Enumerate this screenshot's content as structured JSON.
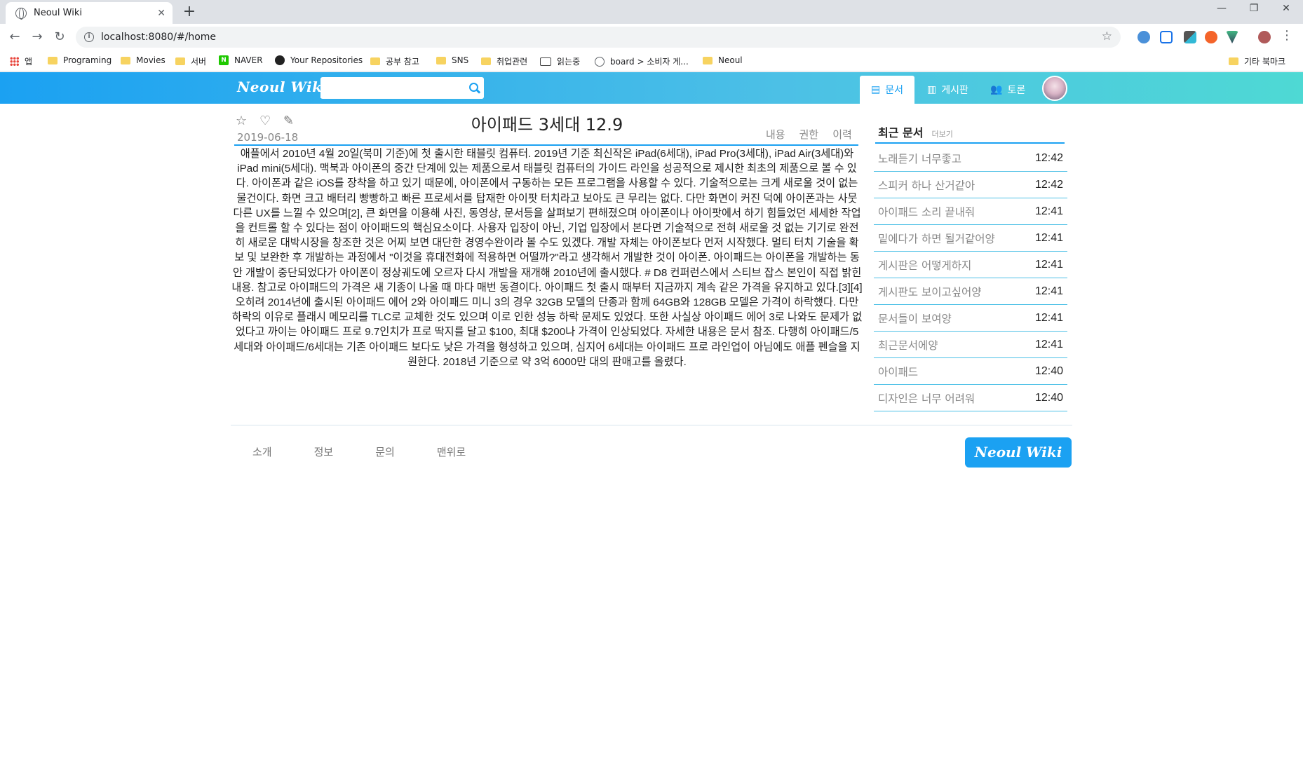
{
  "browser": {
    "tab_title": "Neoul Wiki",
    "tab_close": "✕",
    "new_tab": "+",
    "url": "localhost:8080/#/home",
    "window_controls": [
      "—",
      "❐",
      "✕"
    ],
    "bookmarks": [
      "앱",
      "Programing",
      "Movies",
      "서버",
      "NAVER",
      "Your Repositories",
      "공부 참고",
      "SNS",
      "취업관련",
      "읽는중",
      "board > 소비자 게...",
      "Neoul"
    ],
    "other_bookmarks": "기타 북마크"
  },
  "header": {
    "logo": "Neoul Wiki",
    "search_placeholder": "",
    "nav": [
      {
        "label": "문서",
        "icon": "document-icon"
      },
      {
        "label": "게시판",
        "icon": "clipboard-icon"
      },
      {
        "label": "토론",
        "icon": "users-icon"
      }
    ]
  },
  "document": {
    "title": "아이패드 3세대 12.9",
    "date": "2019-06-18",
    "tabs": [
      "내용",
      "권한",
      "이력"
    ],
    "body": "애플에서 2010년 4월 20일(북미 기준)에 첫 출시한 태블릿 컴퓨터. 2019년 기준 최신작은 iPad(6세대), iPad Pro(3세대), iPad Air(3세대)와 iPad mini(5세대). 맥북과 아이폰의 중간 단계에 있는 제품으로서 태블릿 컴퓨터의 가이드 라인을 성공적으로 제시한 최초의 제품으로 볼 수 있다. 아이폰과 같은 iOS를 장착을 하고 있기 때문에, 아이폰에서 구동하는 모든 프로그램을 사용할 수 있다. 기술적으로는 크게 새로울 것이 없는 물건이다. 화면 크고 배터리 빵빵하고 빠른 프로세서를 탑재한 아이팟 터치라고 보아도 큰 무리는 없다. 다만 화면이 커진 덕에 아이폰과는 사뭇 다른 UX를 느낄 수 있으며[2], 큰 화면을 이용해 사진, 동영상, 문서등을 살펴보기 편해졌으며 아이폰이나 아이팟에서 하기 힘들었던 세세한 작업을 컨트롤 할 수 있다는 점이 아이패드의 핵심요소이다. 사용자 입장이 아닌, 기업 입장에서 본다면 기술적으로 전혀 새로울 것 없는 기기로 완전히 새로운 대박시장을 창조한 것은 어찌 보면 대단한 경영수완이라 볼 수도 있겠다. 개발 자체는 아이폰보다 먼저 시작했다. 멀티 터치 기술을 확보 및 보완한 후 개발하는 과정에서 \"이것을 휴대전화에 적용하면 어떨까?\"라고 생각해서 개발한 것이 아이폰. 아이패드는 아이폰을 개발하는 동안 개발이 중단되었다가 아이폰이 정상궤도에 오르자 다시 개발을 재개해 2010년에 출시했다. # D8 컨퍼런스에서 스티브 잡스 본인이 직접 밝힌 내용. 참고로 아이패드의 가격은 새 기종이 나올 때 마다 매번 동결이다. 아이패드 첫 출시 때부터 지금까지 계속 같은 가격을 유지하고 있다.[3][4] 오히려 2014년에 출시된 아이패드 에어 2와 아이패드 미니 3의 경우 32GB 모델의 단종과 함께 64GB와 128GB 모델은 가격이 하락했다. 다만 하락의 이유로 플래시 메모리를 TLC로 교체한 것도 있으며 이로 인한 성능 하락 문제도 있었다. 또한 사실상 아이패드 에어 3로 나와도 문제가 없었다고 까이는 아이패드 프로 9.7인치가 프로 딱지를 달고 $100, 최대 $200나 가격이 인상되었다. 자세한 내용은 문서 참조. 다행히 아이패드/5세대와 아이패드/6세대는 기존 아이패드 보다도 낮은 가격을 형성하고 있으며, 심지어 6세대는 아이패드 프로 라인업이 아님에도 애플 펜슬을 지원한다. 2018년 기준으로 약 3억 6000만 대의 판매고를 올렸다."
  },
  "sidebar": {
    "title": "최근 문서",
    "more": "더보기",
    "items": [
      {
        "title": "노래듣기 너무좋고",
        "time": "12:42"
      },
      {
        "title": "스피커 하나 산거같아",
        "time": "12:42"
      },
      {
        "title": "아이패드 소리 끝내줘",
        "time": "12:41"
      },
      {
        "title": "밑에다가 하면 될거같어양",
        "time": "12:41"
      },
      {
        "title": "게시판은 어떻게하지",
        "time": "12:41"
      },
      {
        "title": "게시판도 보이고싶어양",
        "time": "12:41"
      },
      {
        "title": "문서들이 보여양",
        "time": "12:41"
      },
      {
        "title": "최근문서에양",
        "time": "12:41"
      },
      {
        "title": "아이패드",
        "time": "12:40"
      },
      {
        "title": "디자인은 너무 어려워",
        "time": "12:40"
      }
    ]
  },
  "footer": {
    "links": [
      "소개",
      "정보",
      "문의",
      "맨위로"
    ],
    "logo": "Neoul Wiki"
  },
  "colors": {
    "accent": "#1ba1f2",
    "header_gradient_end": "#4ed9d4"
  }
}
